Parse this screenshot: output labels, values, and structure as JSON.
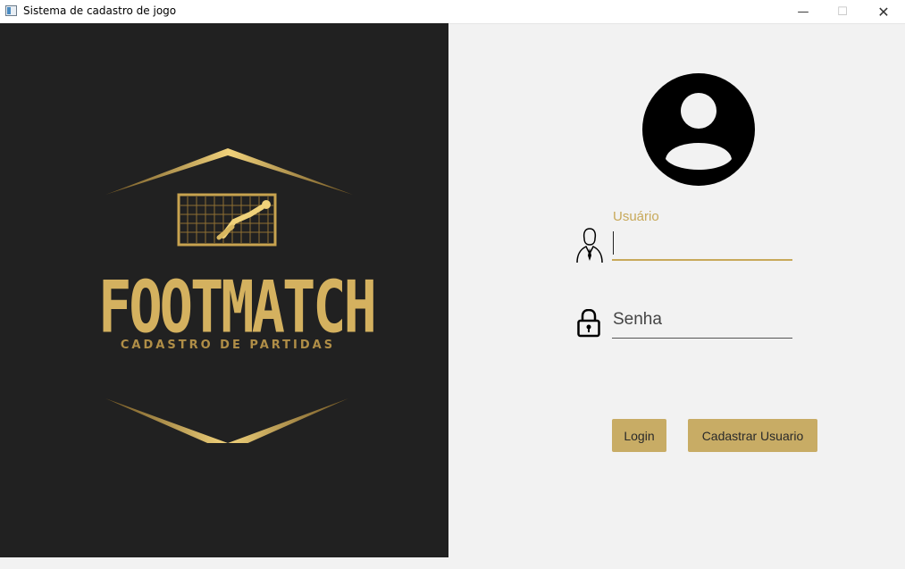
{
  "window": {
    "title": "Sistema de cadastro de jogo",
    "controls": {
      "minimize": "—",
      "maximize": "☐",
      "close": "✕"
    }
  },
  "logo": {
    "title": "FOOTMATCH",
    "subtitle": "CADASTRO DE PARTIDAS",
    "colors": {
      "gold": "#d4b15f",
      "gold_dark": "#8a6a2a",
      "background": "#212121"
    }
  },
  "form": {
    "avatar_icon": "user-circle-icon",
    "username": {
      "label": "Usuário",
      "value": "",
      "icon": "user-outline-icon"
    },
    "password": {
      "placeholder": "Senha",
      "value": "",
      "icon": "lock-icon"
    },
    "buttons": {
      "login": "Login",
      "register": "Cadastrar Usuario"
    }
  },
  "colors": {
    "accent": "#c8a95a",
    "button": "#c8ac65",
    "panel": "#f2f2f2"
  }
}
